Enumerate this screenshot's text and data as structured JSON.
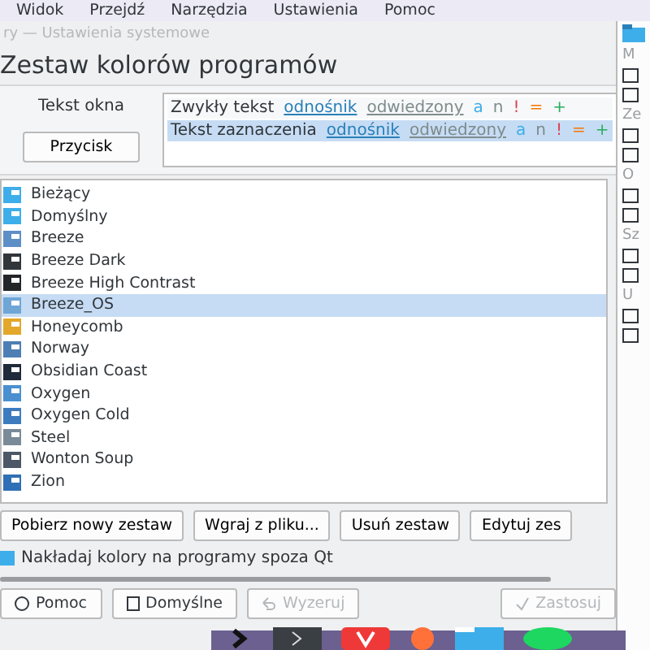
{
  "menu": [
    "Widok",
    "Przejdź",
    "Narzędzia",
    "Ustawienia",
    "Pomoc"
  ],
  "window": {
    "title": "ry — Ustawienia systemowe",
    "heading": "Zestaw kolorów programów"
  },
  "preview": {
    "label": "Tekst okna",
    "button": "Przycisk",
    "rows": [
      {
        "text": "Zwykły tekst",
        "link": "odnośnik",
        "visited": "odwiedzony",
        "selected": false,
        "marks": [
          {
            "text": "a",
            "color": "#3daee9"
          },
          {
            "text": "n",
            "color": "#7f8c8d"
          },
          {
            "text": "!",
            "color": "#da4453"
          },
          {
            "text": "=",
            "color": "#f67400"
          },
          {
            "text": "+",
            "color": "#27ae60"
          }
        ]
      },
      {
        "text": "Tekst zaznaczenia",
        "link": "odnośnik",
        "visited": "odwiedzony",
        "selected": true,
        "marks": [
          {
            "text": "a",
            "color": "#3daee9"
          },
          {
            "text": "n",
            "color": "#7f8c8d"
          },
          {
            "text": "!",
            "color": "#da4453"
          },
          {
            "text": "=",
            "color": "#f67400"
          },
          {
            "text": "+",
            "color": "#27ae60"
          }
        ]
      }
    ]
  },
  "schemes": [
    {
      "name": "Bieżący",
      "color": "#3daee9",
      "selected": false
    },
    {
      "name": "Domyślny",
      "color": "#3daee9",
      "selected": false
    },
    {
      "name": "Breeze",
      "color": "#5d8fc7",
      "selected": false
    },
    {
      "name": "Breeze Dark",
      "color": "#31363b",
      "selected": false
    },
    {
      "name": "Breeze High Contrast",
      "color": "#232629",
      "selected": false
    },
    {
      "name": "Breeze_OS",
      "color": "#6fa6d6",
      "selected": true
    },
    {
      "name": "Honeycomb",
      "color": "#e3a82a",
      "selected": false
    },
    {
      "name": "Norway",
      "color": "#4d7fb5",
      "selected": false
    },
    {
      "name": "Obsidian Coast",
      "color": "#1f2a3a",
      "selected": false
    },
    {
      "name": "Oxygen",
      "color": "#4a90d0",
      "selected": false
    },
    {
      "name": "Oxygen Cold",
      "color": "#3d7bbf",
      "selected": false
    },
    {
      "name": "Steel",
      "color": "#7a8a99",
      "selected": false
    },
    {
      "name": "Wonton Soup",
      "color": "#4c5866",
      "selected": false
    },
    {
      "name": "Zion",
      "color": "#2f6fb5",
      "selected": false
    }
  ],
  "actions": [
    "Pobierz nowy zestaw",
    "Wgraj z pliku...",
    "Usuń zestaw",
    "Edytuj zes"
  ],
  "apply_non_qt": {
    "label": "Nakładaj kolory na programy spoza Qt",
    "checked": true
  },
  "footer": [
    {
      "label": "Pomoc",
      "kind": "help",
      "disabled": false
    },
    {
      "label": "Domyślne",
      "kind": "defaults",
      "disabled": false
    },
    {
      "label": "Wyzeruj",
      "kind": "reset",
      "disabled": true
    },
    {
      "label": "Zastosuj",
      "kind": "apply",
      "disabled": true
    }
  ],
  "side_sections": [
    "M",
    "Ze",
    "O",
    "Sz",
    "U"
  ]
}
